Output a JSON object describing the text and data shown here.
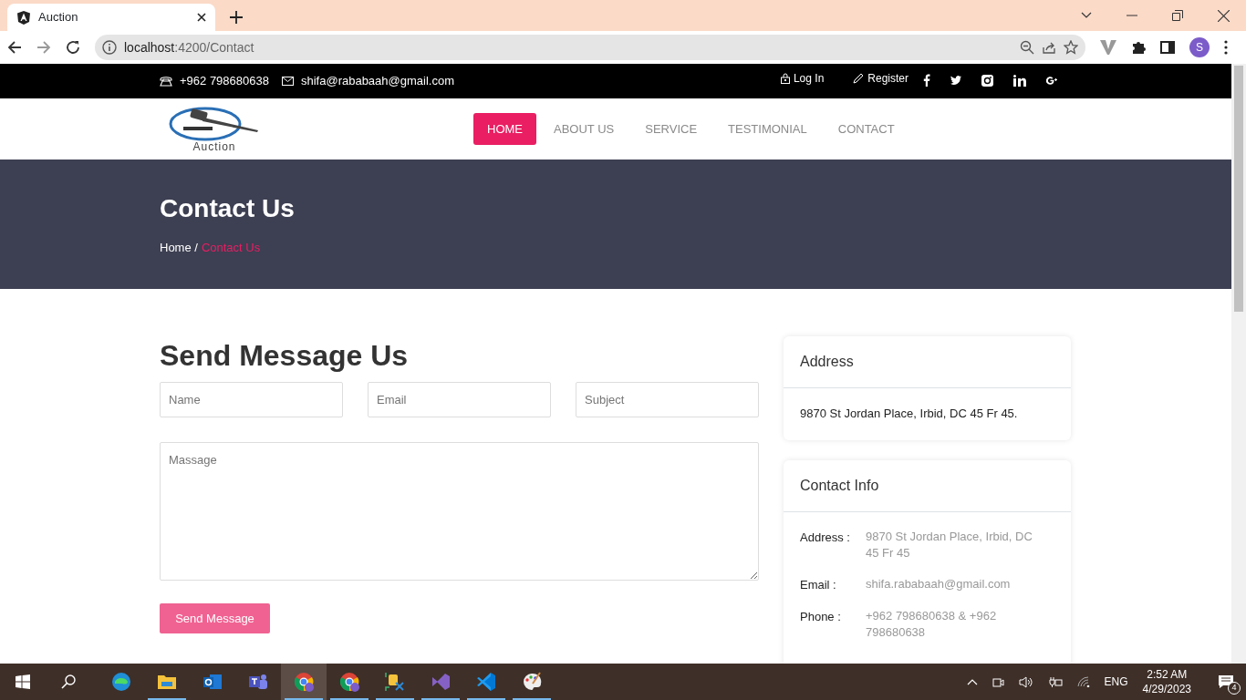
{
  "browser": {
    "tab_title": "Auction",
    "url_host": "localhost",
    "url_path": ":4200/Contact",
    "profile_initial": "S"
  },
  "topbar": {
    "phone": "+962 798680638",
    "email": "shifa@rababaah@gmail.com",
    "login": "Log In",
    "register": "Register"
  },
  "logo_text": "Auction",
  "nav": [
    {
      "label": "HOME",
      "selected": true
    },
    {
      "label": "ABOUT US",
      "selected": false
    },
    {
      "label": "SERVICE",
      "selected": false
    },
    {
      "label": "TESTIMONIAL",
      "selected": false
    },
    {
      "label": "CONTACT",
      "selected": false
    }
  ],
  "hero": {
    "title": "Contact Us",
    "breadcrumb": [
      {
        "label": "Home /",
        "current": false
      },
      {
        "label": "Contact Us",
        "current": true
      }
    ]
  },
  "form": {
    "title": "Send Message Us",
    "fields": [
      {
        "placeholder": "Name"
      },
      {
        "placeholder": "Email"
      },
      {
        "placeholder": "Subject"
      }
    ],
    "message_placeholder": "Massage",
    "submit": "Send Message"
  },
  "address_card": {
    "title": "Address",
    "text": "9870 St Jordan Place, Irbid, DC 45 Fr 45."
  },
  "contact_card": {
    "title": "Contact Info",
    "rows": [
      {
        "label": "Address :",
        "value": "9870 St Jordan Place, Irbid, DC 45 Fr 45"
      },
      {
        "label": "Email :",
        "value": "shifa.rababaah@gmail.com"
      },
      {
        "label": "Phone :",
        "value": "+962 798680638 & +962 798680638"
      }
    ]
  },
  "taskbar": {
    "apps": [
      {
        "kind": "edge",
        "running": false,
        "selected": false
      },
      {
        "kind": "folder",
        "running": true,
        "selected": false
      },
      {
        "kind": "outlook",
        "running": false,
        "selected": false
      },
      {
        "kind": "teams",
        "running": false,
        "selected": false
      },
      {
        "kind": "chrome",
        "running": true,
        "selected": true
      },
      {
        "kind": "chrome",
        "running": true,
        "selected": false
      },
      {
        "kind": "tool",
        "running": true,
        "selected": false
      },
      {
        "kind": "studio",
        "running": true,
        "selected": false
      },
      {
        "kind": "code",
        "running": true,
        "selected": false
      },
      {
        "kind": "paint",
        "running": true,
        "selected": false
      }
    ],
    "language": "ENG",
    "time": "2:52 AM",
    "date": "4/29/2023",
    "notifications": "4"
  }
}
